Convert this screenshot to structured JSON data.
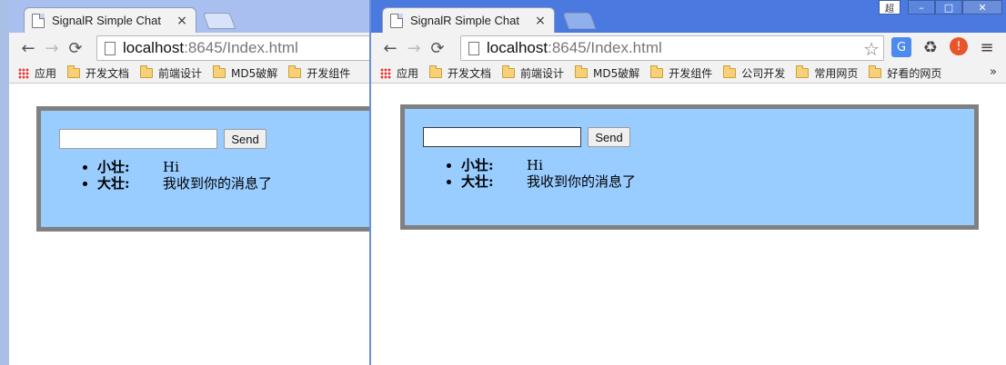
{
  "tab": {
    "title": "SignalR Simple Chat",
    "close": "×"
  },
  "window_controls": {
    "user": "超",
    "minimize": "–",
    "maximize": "□",
    "close": "✕"
  },
  "nav": {
    "back": "←",
    "forward": "→",
    "reload": "⟳"
  },
  "address": {
    "host": "localhost",
    "rest": ":8645/Index.html"
  },
  "bookmarks": {
    "apps": "应用",
    "folders": [
      "开发文档",
      "前端设计",
      "MD5破解",
      "开发组件",
      "公司开发",
      "常用网页",
      "好看的网页"
    ],
    "more": "»"
  },
  "chat": {
    "input_value": "",
    "send_label": "Send",
    "messages": [
      {
        "name": "小壮:",
        "text": "Hi"
      },
      {
        "name": "大壮:",
        "text": "我收到你的消息了"
      }
    ]
  },
  "colors": {
    "chat_background": "#99ccff",
    "chat_border": "#808080",
    "active_frame": "#4a7ae0",
    "inactive_frame": "#a9bff0"
  }
}
